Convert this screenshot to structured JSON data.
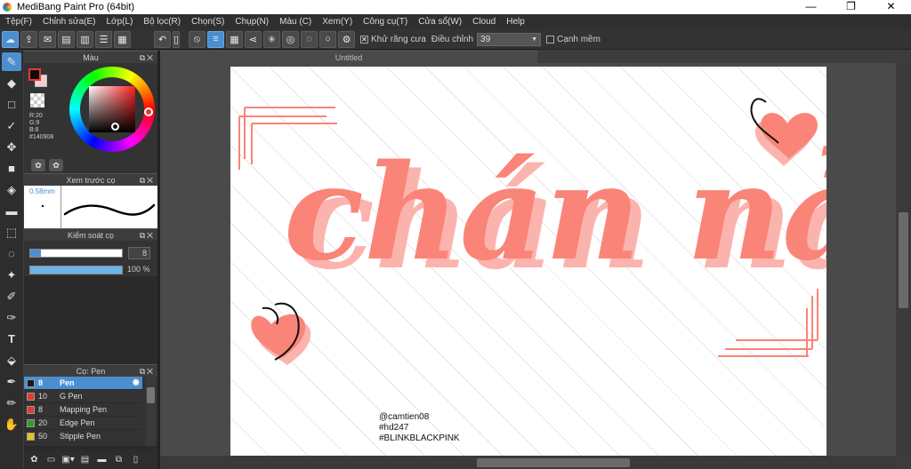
{
  "window": {
    "title": "MediBang Paint Pro (64bit)",
    "controls": [
      "—",
      "❐",
      "✕"
    ]
  },
  "menu": [
    "Tệp(F)",
    "Chỉnh sửa(E)",
    "Lớp(L)",
    "Bộ lọc(R)",
    "Chọn(S)",
    "Chụp(N)",
    "Màu (C)",
    "Xem(Y)",
    "Công cụ(T)",
    "Cửa sổ(W)",
    "Cloud",
    "Help"
  ],
  "toolbar": {
    "antialias_label": "Khử răng cưa",
    "adjust_label": "Điều chỉnh",
    "adjust_value": "39",
    "smooth_label": "Cạnh mềm"
  },
  "document": {
    "tab_title": "Untitled",
    "artwork_text": "chán nản",
    "credit": [
      "@camtien08",
      "#hd247",
      "#BLINKBLACKPINK"
    ]
  },
  "panels": {
    "color": {
      "title": "Màu",
      "r": "R:20",
      "g": "G:9",
      "b": "B:8",
      "hex": "#140908",
      "fg_color": "#140908",
      "bg_color": "#f0d0d0"
    },
    "brush_preview": {
      "title": "Xem trước cọ",
      "size": "0.58mm"
    },
    "brush_control": {
      "title": "Kiểm soát cọ",
      "size_value": "8",
      "size_fraction": 0.12,
      "opacity_value": "100 %",
      "opacity_fraction": 1.0
    },
    "brush_list": {
      "title": "Cọ: Pen",
      "items": [
        {
          "size": "8",
          "name": "Pen",
          "color": "#1a1a1a"
        },
        {
          "size": "10",
          "name": "G Pen",
          "color": "#e53935"
        },
        {
          "size": "8",
          "name": "Mapping Pen",
          "color": "#e53935"
        },
        {
          "size": "20",
          "name": "Edge Pen",
          "color": "#2e9e2e"
        },
        {
          "size": "50",
          "name": "Stipple Pen",
          "color": "#e5c51a"
        }
      ]
    }
  },
  "artwork_color": "#fa8478"
}
